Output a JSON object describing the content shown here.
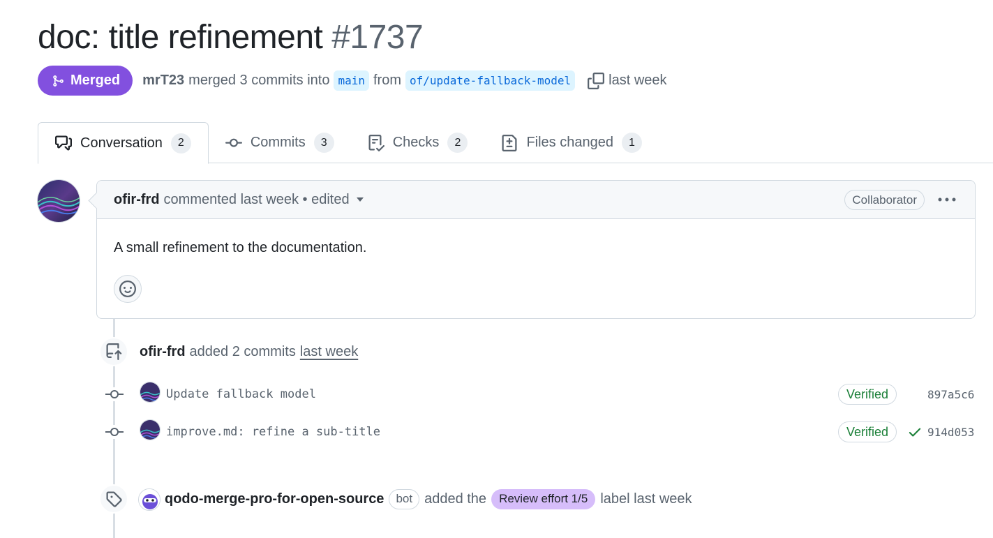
{
  "pr": {
    "title": "doc: title refinement",
    "number": "#1737",
    "state": "Merged",
    "merged_by": "mrT23",
    "merge_text": "merged 3 commits into",
    "base_branch": "main",
    "from_text": "from",
    "head_branch": "of/update-fallback-model",
    "time": "last week"
  },
  "tabs": [
    {
      "label": "Conversation",
      "count": "2",
      "icon": "comment-discussion-icon"
    },
    {
      "label": "Commits",
      "count": "3",
      "icon": "git-commit-icon"
    },
    {
      "label": "Checks",
      "count": "2",
      "icon": "checklist-icon"
    },
    {
      "label": "Files changed",
      "count": "1",
      "icon": "file-diff-icon"
    }
  ],
  "comment": {
    "author": "ofir-frd",
    "meta": "commented last week • edited",
    "role": "Collaborator",
    "body": "A small refinement to the documentation."
  },
  "push_event": {
    "author": "ofir-frd",
    "text": "added 2 commits",
    "time": "last week"
  },
  "commits": [
    {
      "message": "Update fallback model",
      "verified": "Verified",
      "sha": "897a5c6",
      "check": false
    },
    {
      "message": "improve.md: refine a sub-title",
      "verified": "Verified",
      "sha": "914d053",
      "check": true
    }
  ],
  "label_event": {
    "author": "qodo-merge-pro-for-open-source",
    "badge": "bot",
    "text_before": "added the",
    "label": "Review effort 1/5",
    "text_after": "label last week",
    "label_color": "#d6bdfa"
  },
  "colors": {
    "merged": "#8250df",
    "branch_bg": "#ddf4ff",
    "branch_fg": "#0969da",
    "verified": "#1a7f37"
  }
}
